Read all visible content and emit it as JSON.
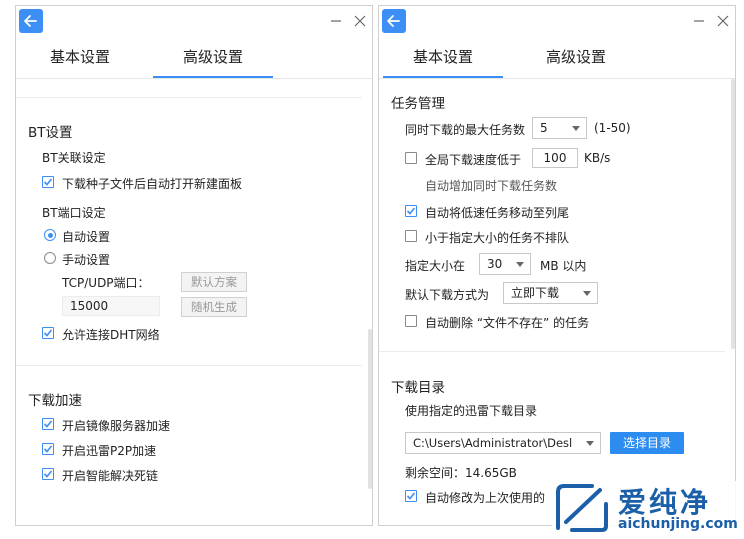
{
  "left": {
    "tabs": [
      "基本设置",
      "高级设置"
    ],
    "active_tab": 1,
    "bt_section": {
      "title": "BT设置",
      "assoc_title": "BT关联设定",
      "auto_open_label": "下载种子文件后自动打开新建面板",
      "port_title": "BT端口设定",
      "auto_setting_label": "自动设置",
      "manual_setting_label": "手动设置",
      "port_label": "TCP/UDP端口：",
      "port_value": "15000",
      "default_button": "默认方案",
      "random_button": "随机生成",
      "dht_label": "允许连接DHT网络"
    },
    "accel_section": {
      "title": "下载加速",
      "mirror_label": "开启镜像服务器加速",
      "p2p_label": "开启迅雷P2P加速",
      "deadlink_label": "开启智能解决死链"
    }
  },
  "right": {
    "tabs": [
      "基本设置",
      "高级设置"
    ],
    "active_tab": 0,
    "task_section": {
      "title": "任务管理",
      "max_tasks_label": "同时下载的最大任务数",
      "max_tasks_value": "5",
      "max_tasks_range": "(1-50)",
      "speed_label": "全局下载速度低于",
      "speed_value": "100",
      "speed_unit": "KB/s",
      "speed_hint": "自动增加同时下载任务数",
      "move_slow_label": "自动将低速任务移动至列尾",
      "no_queue_label": "小于指定大小的任务不排队",
      "size_label": "指定大小在",
      "size_value": "30",
      "size_unit": "MB 以内",
      "download_mode_label": "默认下载方式为",
      "download_mode_value": "立即下载",
      "delete_missing_label": "自动删除 “文件不存在” 的任务"
    },
    "dir_section": {
      "title": "下载目录",
      "use_dir_label": "使用指定的迅雷下载目录",
      "dir_value": "C:\\Users\\Administrator\\Desl",
      "choose_button": "选择目录",
      "free_space": "剩余空间：14.65GB",
      "auto_modify_label": "自动修改为上次使用的"
    }
  },
  "watermark": {
    "brand": "爱纯净",
    "url": "aichunjing.com"
  },
  "colors": {
    "accent": "#3d8ff5",
    "button_primary": "#2d8cf0"
  }
}
